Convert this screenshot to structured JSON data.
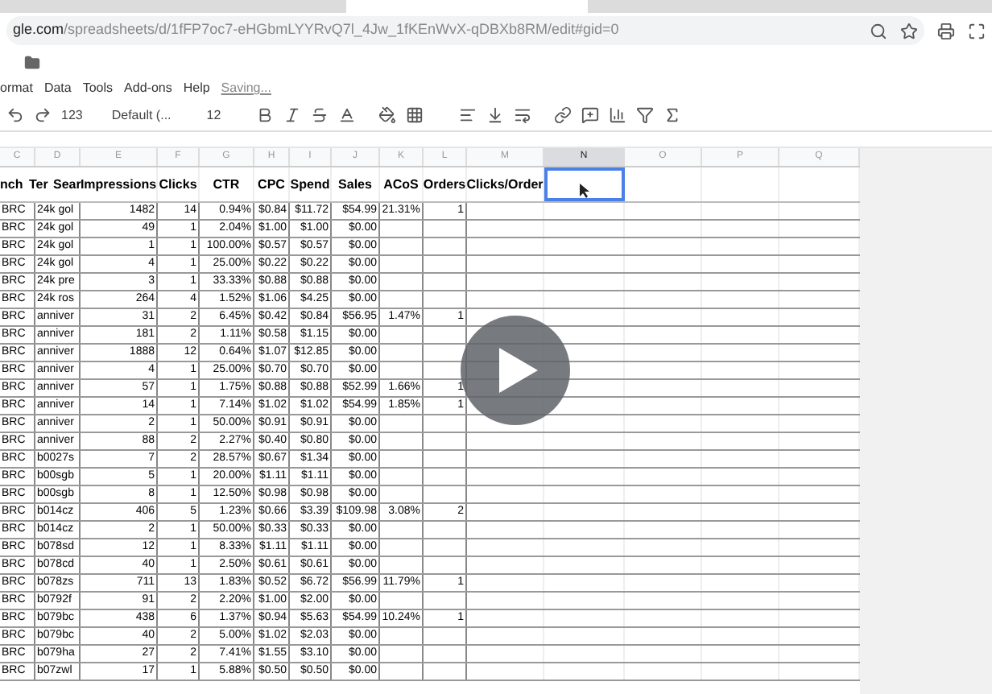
{
  "browser": {
    "url_domain": "gle.com",
    "url_path": "/spreadsheets/d/1fFP7oc7-eHGbmLYYRvQ7l_4Jw_1fKEnWvX-qDBXb8RM/edit#gid=0"
  },
  "menu": [
    "ormat",
    "Data",
    "Tools",
    "Add-ons",
    "Help"
  ],
  "save_status": "Saving...",
  "toolbar": {
    "number_format": "123",
    "font": "Default (...",
    "font_size": "12"
  },
  "sheet": {
    "columns": [
      {
        "letter": "C",
        "selected": false
      },
      {
        "letter": "D",
        "selected": false
      },
      {
        "letter": "E",
        "selected": false
      },
      {
        "letter": "F",
        "selected": false
      },
      {
        "letter": "G",
        "selected": false
      },
      {
        "letter": "H",
        "selected": false
      },
      {
        "letter": "I",
        "selected": false
      },
      {
        "letter": "J",
        "selected": false
      },
      {
        "letter": "K",
        "selected": false
      },
      {
        "letter": "L",
        "selected": false
      },
      {
        "letter": "M",
        "selected": false
      },
      {
        "letter": "N",
        "selected": true
      },
      {
        "letter": "O",
        "selected": false
      },
      {
        "letter": "P",
        "selected": false
      },
      {
        "letter": "Q",
        "selected": false
      }
    ],
    "header_row": [
      "nch",
      "Ter",
      "Sear",
      "Impressions",
      "Clicks",
      "CTR",
      "CPC",
      "Spend",
      "Sales",
      "ACoS",
      "Orders",
      "Clicks/Order"
    ],
    "rows": [
      {
        "cells": [
          "BRC",
          "24k gol",
          "1482",
          "14",
          "0.94%",
          "$0.84",
          "$11.72",
          "$54.99",
          "21.31%",
          "1"
        ]
      },
      {
        "cells": [
          "BRC",
          "24k gol",
          "49",
          "1",
          "2.04%",
          "$1.00",
          "$1.00",
          "$0.00"
        ]
      },
      {
        "cells": [
          "BRC",
          "24k gol",
          "1",
          "1",
          "100.00%",
          "$0.57",
          "$0.57",
          "$0.00"
        ]
      },
      {
        "cells": [
          "BRC",
          "24k gol",
          "4",
          "1",
          "25.00%",
          "$0.22",
          "$0.22",
          "$0.00"
        ]
      },
      {
        "cells": [
          "BRC",
          "24k pre",
          "3",
          "1",
          "33.33%",
          "$0.88",
          "$0.88",
          "$0.00"
        ]
      },
      {
        "cells": [
          "BRC",
          "24k ros",
          "264",
          "4",
          "1.52%",
          "$1.06",
          "$4.25",
          "$0.00"
        ]
      },
      {
        "cells": [
          "BRC",
          "anniver",
          "31",
          "2",
          "6.45%",
          "$0.42",
          "$0.84",
          "$56.95",
          "1.47%",
          "1"
        ]
      },
      {
        "cells": [
          "BRC",
          "anniver",
          "181",
          "2",
          "1.11%",
          "$0.58",
          "$1.15",
          "$0.00"
        ]
      },
      {
        "cells": [
          "BRC",
          "anniver",
          "1888",
          "12",
          "0.64%",
          "$1.07",
          "$12.85",
          "$0.00"
        ]
      },
      {
        "cells": [
          "BRC",
          "anniver",
          "4",
          "1",
          "25.00%",
          "$0.70",
          "$0.70",
          "$0.00"
        ]
      },
      {
        "cells": [
          "BRC",
          "anniver",
          "57",
          "1",
          "1.75%",
          "$0.88",
          "$0.88",
          "$52.99",
          "1.66%",
          "1"
        ]
      },
      {
        "cells": [
          "BRC",
          "anniver",
          "14",
          "1",
          "7.14%",
          "$1.02",
          "$1.02",
          "$54.99",
          "1.85%",
          "1"
        ]
      },
      {
        "cells": [
          "BRC",
          "anniver",
          "2",
          "1",
          "50.00%",
          "$0.91",
          "$0.91",
          "$0.00"
        ]
      },
      {
        "cells": [
          "BRC",
          "anniver",
          "88",
          "2",
          "2.27%",
          "$0.40",
          "$0.80",
          "$0.00"
        ]
      },
      {
        "cells": [
          "BRC",
          "b0027s",
          "7",
          "2",
          "28.57%",
          "$0.67",
          "$1.34",
          "$0.00"
        ]
      },
      {
        "cells": [
          "BRC",
          "b00sgb",
          "5",
          "1",
          "20.00%",
          "$1.11",
          "$1.11",
          "$0.00"
        ]
      },
      {
        "cells": [
          "BRC",
          "b00sgb",
          "8",
          "1",
          "12.50%",
          "$0.98",
          "$0.98",
          "$0.00"
        ]
      },
      {
        "cells": [
          "BRC",
          "b014cz",
          "406",
          "5",
          "1.23%",
          "$0.66",
          "$3.39",
          "$109.98",
          "3.08%",
          "2"
        ]
      },
      {
        "cells": [
          "BRC",
          "b014cz",
          "2",
          "1",
          "50.00%",
          "$0.33",
          "$0.33",
          "$0.00"
        ]
      },
      {
        "cells": [
          "BRC",
          "b078sd",
          "12",
          "1",
          "8.33%",
          "$1.11",
          "$1.11",
          "$0.00"
        ]
      },
      {
        "cells": [
          "BRC",
          "b078cd",
          "40",
          "1",
          "2.50%",
          "$0.61",
          "$0.61",
          "$0.00"
        ]
      },
      {
        "cells": [
          "BRC",
          "b078zs",
          "711",
          "13",
          "1.83%",
          "$0.52",
          "$6.72",
          "$56.99",
          "11.79%",
          "1"
        ]
      },
      {
        "cells": [
          "BRC",
          "b0792f",
          "91",
          "2",
          "2.20%",
          "$1.00",
          "$2.00",
          "$0.00"
        ]
      },
      {
        "cells": [
          "BRC",
          "b079bc",
          "438",
          "6",
          "1.37%",
          "$0.94",
          "$5.63",
          "$54.99",
          "10.24%",
          "1"
        ]
      },
      {
        "cells": [
          "BRC",
          "b079bc",
          "40",
          "2",
          "5.00%",
          "$1.02",
          "$2.03",
          "$0.00"
        ]
      },
      {
        "cells": [
          "BRC",
          "b079ha",
          "27",
          "2",
          "7.41%",
          "$1.55",
          "$3.10",
          "$0.00"
        ]
      },
      {
        "cells": [
          "BRC",
          "b07zwl",
          "17",
          "1",
          "5.88%",
          "$0.50",
          "$0.50",
          "$0.00"
        ]
      }
    ]
  }
}
